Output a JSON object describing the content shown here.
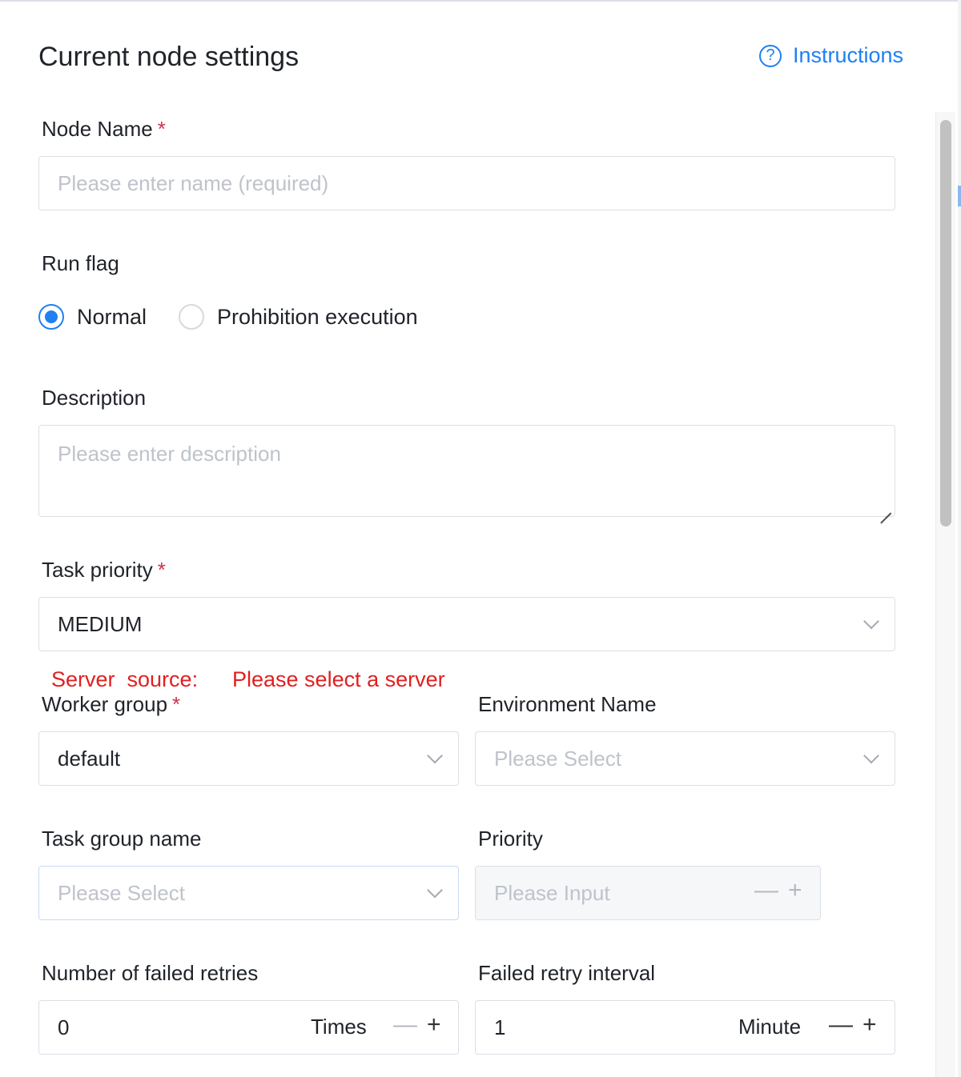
{
  "header": {
    "title": "Current node settings",
    "instructions_label": "Instructions",
    "help_icon_glyph": "?"
  },
  "form": {
    "node_name": {
      "label": "Node Name",
      "required_mark": "*",
      "placeholder": "Please enter name (required)"
    },
    "run_flag": {
      "label": "Run flag",
      "options": [
        {
          "label": "Normal",
          "checked": true
        },
        {
          "label": "Prohibition execution",
          "checked": false
        }
      ]
    },
    "description": {
      "label": "Description",
      "placeholder": "Please enter description"
    },
    "task_priority": {
      "label": "Task priority",
      "required_mark": "*",
      "value": "MEDIUM"
    },
    "server_source": {
      "label": "Server  source:",
      "hint": "Please select a server"
    },
    "worker_group": {
      "label": "Worker group",
      "required_mark": "*",
      "value": "default"
    },
    "environment_name": {
      "label": "Environment Name",
      "placeholder": "Please Select"
    },
    "task_group_name": {
      "label": "Task group name",
      "placeholder": "Please Select"
    },
    "priority": {
      "label": "Priority",
      "placeholder": "Please Input"
    },
    "failed_retries": {
      "label": "Number of failed retries",
      "value": "0",
      "unit": "Times"
    },
    "retry_interval": {
      "label": "Failed retry interval",
      "value": "1",
      "unit": "Minute"
    }
  },
  "stepper": {
    "minus": "—",
    "plus": "+"
  },
  "colors": {
    "accent": "#2080f0",
    "required": "#d03050",
    "error_text": "#e02020",
    "border": "#dcdfe6"
  }
}
